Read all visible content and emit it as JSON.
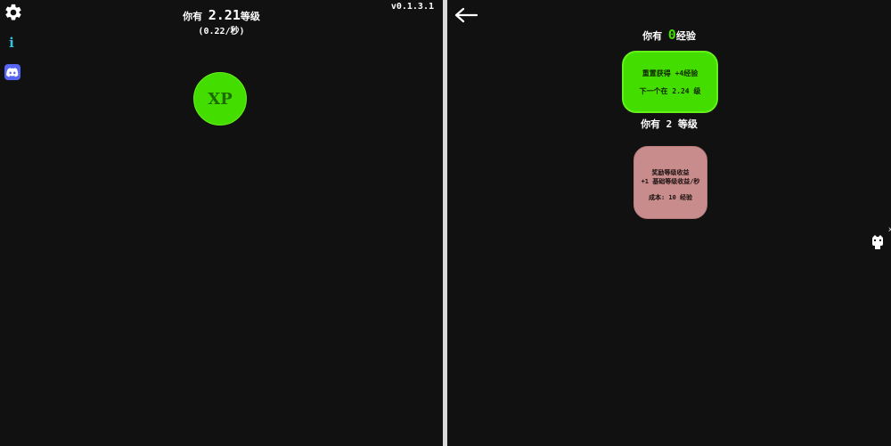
{
  "left": {
    "level_prefix": "你有",
    "level_value": "2.21",
    "level_suffix": "等级",
    "rate": "(0.22/秒)",
    "version": "v0.1.3.1",
    "xp_button_label": "XP",
    "sidebar_icons": [
      "gear-icon",
      "info-icon",
      "discord-icon"
    ]
  },
  "right": {
    "xp_prefix": "你有",
    "xp_value": "0",
    "xp_suffix": "经验",
    "reset": {
      "line1": "重置获得 +4经验",
      "line2": "下一个在 2.24 级"
    },
    "level_text": "你有 2 等级",
    "upgrade": {
      "title": "奖励等级收益",
      "desc": "+1 基础等级收益/秒",
      "cost": "成本: 10 经验"
    },
    "edge_mark": "x"
  },
  "colors": {
    "background": "#111111",
    "accent_green": "#44dd00",
    "upgrade_pink": "#c98c8c",
    "info_cyan": "#36c2d8",
    "discord_blue": "#5865f2"
  }
}
